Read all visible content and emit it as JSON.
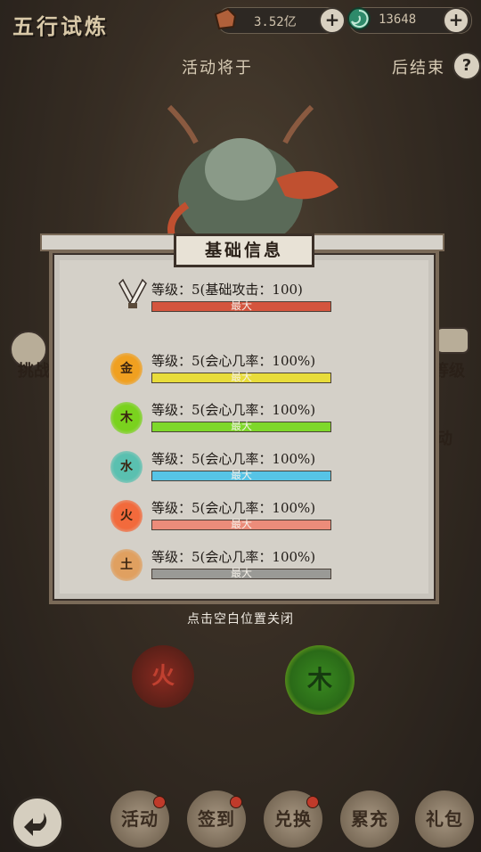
{
  "header": {
    "title": "五行试炼",
    "currency1_value": "3.52亿",
    "currency2_value": "13648",
    "plus_symbol": "+",
    "notice_prefix": "活动将于",
    "notice_suffix": "后结束",
    "help_symbol": "?"
  },
  "background": {
    "left_label": "挑战",
    "right_label": "等级",
    "right_label2": "动",
    "fire_char": "火",
    "wood_char": "木"
  },
  "modal": {
    "title": "基础信息",
    "attack_row": {
      "label": "等级：5(基础攻击：100)",
      "bar_text": "最大",
      "bar_color": "#d4553e",
      "fill_fraction": 1
    },
    "elements": [
      {
        "char": "金",
        "label": "等级：5(会心几率：100%)",
        "bar_text": "最大",
        "bar_color": "#e8dc3a",
        "orb_color": "#f0a020"
      },
      {
        "char": "木",
        "label": "等级：5(会心几率：100%)",
        "bar_text": "最大",
        "bar_color": "#7ed82a",
        "orb_color": "#7ad21e"
      },
      {
        "char": "水",
        "label": "等级：5(会心几率：100%)",
        "bar_text": "最大",
        "bar_color": "#56c4e6",
        "orb_color": "#5ac0b0"
      },
      {
        "char": "火",
        "label": "等级：5(会心几率：100%)",
        "bar_text": "最大",
        "bar_color": "#ec8c7a",
        "orb_color": "#f26a3c"
      },
      {
        "char": "土",
        "label": "等级：5(会心几率：100%)",
        "bar_text": "最大",
        "bar_color": "#9a9a96",
        "orb_color": "#e0a060"
      }
    ],
    "close_hint": "点击空白位置关闭"
  },
  "bottom_tabs": [
    {
      "label": "活动",
      "badge": true
    },
    {
      "label": "签到",
      "badge": true
    },
    {
      "label": "兑换",
      "badge": true
    },
    {
      "label": "累充",
      "badge": false
    },
    {
      "label": "礼包",
      "badge": false
    }
  ],
  "colors": {
    "accent_red": "#d4553e",
    "badge_red": "#c03a2a"
  }
}
